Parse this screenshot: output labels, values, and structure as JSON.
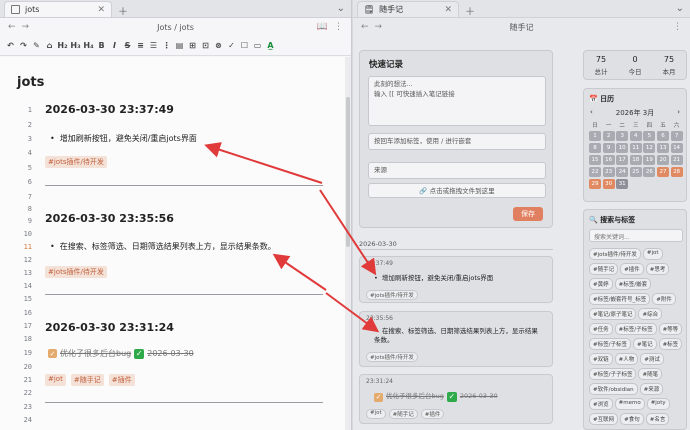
{
  "left_pane": {
    "tab_title": "jots",
    "breadcrumb": "Jots / jots",
    "doc_title": "jots",
    "toolbar": [
      "↶",
      "↷",
      "✎",
      "⌂",
      "H₂",
      "H₃",
      "H₄",
      "B",
      "I",
      "S",
      "≡",
      "☰",
      "⋮",
      "▤",
      "⊞",
      "⊡",
      "⊗",
      "✓",
      "☐",
      "▭",
      "A̲"
    ],
    "entries": [
      {
        "heading_line": "1",
        "heading": "2026-03-30 23:37:49",
        "content_line": "3",
        "bullet": "增加刷新按钮，避免关闭/重启jots界面",
        "tags": [
          "#jots插件/待开发"
        ]
      },
      {
        "heading_line": "9",
        "heading": "2026-03-30 23:35:56",
        "content_line": "11",
        "bullet": "在搜索、标签筛选、日期筛选结果列表上方，显示结果条数。",
        "tags": [
          "#jots插件/待开发"
        ]
      },
      {
        "heading_line": "17",
        "heading": "2026-03-30 23:31:24",
        "content_line": "19",
        "done_text": "优化子很多后台bug",
        "done_date": "2026-03-30",
        "tags": [
          "#jot",
          "#随手记",
          "#插件"
        ]
      }
    ],
    "line_numbers": [
      "1",
      "2",
      "3",
      "4",
      "5",
      "6",
      "7",
      "8",
      "9",
      "10",
      "11",
      "12",
      "13",
      "14",
      "15",
      "16",
      "17",
      "18",
      "19",
      "20",
      "21",
      "22",
      "23",
      "24"
    ]
  },
  "right_pane": {
    "tab_title": "随手记",
    "breadcrumb": "随手记",
    "quick": {
      "title": "快速记录",
      "placeholder_line1": "此刻的想法...",
      "placeholder_line2": "输入 [[ 可快速插入笔记链接",
      "tag_placeholder": "按回车添加标签，使用 / 进行嵌套",
      "source_placeholder": "来源",
      "upload_label": "🔗 点击或拖拽文件到这里",
      "save_label": "保存"
    },
    "date_header": "2026-03-30",
    "cards": [
      {
        "time": "23:37:49",
        "text": "增加刷新按钮，避免关闭/重启jots界面",
        "tags": [
          "#jots插件/待开发"
        ]
      },
      {
        "time": "23:35:56",
        "text": "在搜索、标签筛选、日期筛选结果列表上方，显示结果条数。",
        "tags": [
          "#jots插件/待开发"
        ]
      },
      {
        "time": "23:31:24",
        "text": "优化子很多后台bug",
        "date": "2026-03-30",
        "tags": [
          "#jot",
          "#随手记",
          "#插件"
        ]
      }
    ],
    "stats": [
      {
        "num": "75",
        "label": "总计"
      },
      {
        "num": "0",
        "label": "今日"
      },
      {
        "num": "75",
        "label": "本月"
      }
    ],
    "calendar": {
      "title": "📅 日历",
      "prev": "‹",
      "month": "2026年 3月",
      "next": "›",
      "weekdays": [
        "日",
        "一",
        "二",
        "三",
        "四",
        "五",
        "六"
      ],
      "days": [
        "1",
        "2",
        "3",
        "4",
        "5",
        "6",
        "7",
        "8",
        "9",
        "10",
        "11",
        "12",
        "13",
        "14",
        "15",
        "16",
        "17",
        "18",
        "19",
        "20",
        "21",
        "22",
        "23",
        "24",
        "25",
        "26",
        "27",
        "28",
        "29",
        "30",
        "31"
      ]
    },
    "search": {
      "title": "🔍 搜索与标签",
      "placeholder": "搜索关键词...",
      "tags": [
        "#jots插件/待开发",
        "#jot",
        "#随手记",
        "#插件",
        "#思考",
        "#黄婷",
        "#标签/嵌套",
        "#标签/嵌套符号_标签",
        "#附件",
        "#笔记/原子笔记",
        "#综合",
        "#任务",
        "#标签/子标签",
        "#等等",
        "#标签/子标签",
        "#笔记",
        "#标签",
        "#双链",
        "#人物",
        "#测试",
        "#标签/子子标签",
        "#随笔",
        "#软件/obsidian",
        "#来源",
        "#浏览",
        "#memo",
        "#joty",
        "#互联网",
        "#食句",
        "#名言"
      ]
    }
  }
}
